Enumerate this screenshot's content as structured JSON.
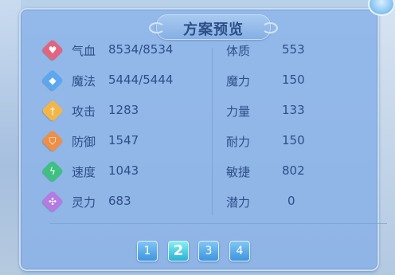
{
  "title": "方案预览",
  "left_stats": [
    {
      "label": "气血",
      "value": "8534/8534",
      "icon": "heart-icon",
      "color": "#e1657f"
    },
    {
      "label": "魔法",
      "value": "5444/5444",
      "icon": "diamond-icon",
      "color": "#5ba8ef"
    },
    {
      "label": "攻击",
      "value": "1283",
      "icon": "sword-icon",
      "color": "#f2b648"
    },
    {
      "label": "防御",
      "value": "1547",
      "icon": "shield-icon",
      "color": "#ee8f45"
    },
    {
      "label": "速度",
      "value": "1043",
      "icon": "lightning-icon",
      "color": "#3fc083"
    },
    {
      "label": "灵力",
      "value": "683",
      "icon": "spirit-icon",
      "color": "#b47be0"
    }
  ],
  "right_stats": [
    {
      "label": "体质",
      "value": "553"
    },
    {
      "label": "魔力",
      "value": "150"
    },
    {
      "label": "力量",
      "value": "133"
    },
    {
      "label": "耐力",
      "value": "150"
    },
    {
      "label": "敏捷",
      "value": "802"
    },
    {
      "label": "潜力",
      "value": "0"
    }
  ],
  "pages": [
    "1",
    "2",
    "3",
    "4"
  ],
  "active_page": "2"
}
